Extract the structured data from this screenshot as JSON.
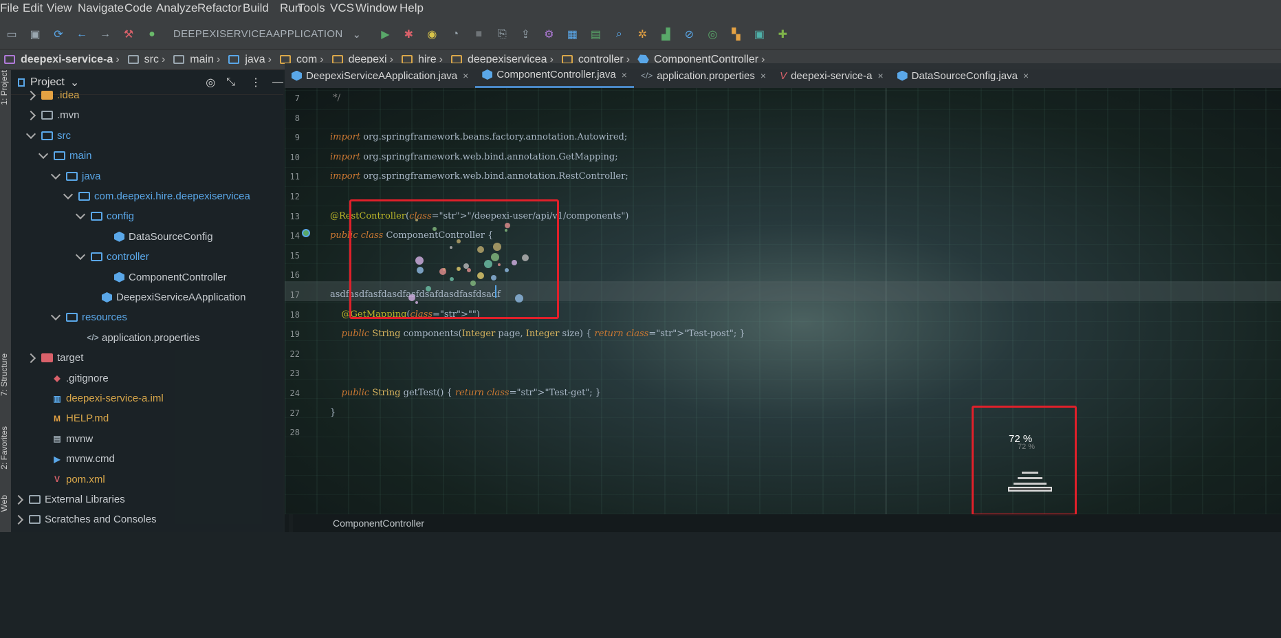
{
  "menu": [
    "File",
    "Edit",
    "View",
    "Navigate",
    "Code",
    "Analyze",
    "Refactor",
    "Build",
    "Run",
    "Tools",
    "VCS",
    "Window",
    "Help"
  ],
  "toolbar": {
    "run_config": "DEEPEXISERVICEAAPPLICATION"
  },
  "breadcrumbs": [
    "deepexi-service-a",
    "src",
    "main",
    "java",
    "com",
    "deepexi",
    "hire",
    "deepexiservicea",
    "controller",
    "ComponentController"
  ],
  "side_tabs": {
    "project": "1: Project",
    "structure": "7: Structure",
    "favorites": "2: Favorites",
    "web": "Web"
  },
  "project_panel": {
    "title": "Project",
    "tree": [
      {
        "label": ".idea",
        "color": "#d9a74a"
      },
      {
        "label": ".mvn",
        "color": "#c8ccd0"
      },
      {
        "label": "src",
        "color": "#5aa7e8"
      },
      {
        "label": "main",
        "color": "#5aa7e8"
      },
      {
        "label": "java",
        "color": "#5aa7e8"
      },
      {
        "label": "com.deepexi.hire.deepexiservicea",
        "color": "#5aa7e8"
      },
      {
        "label": "config",
        "color": "#5aa7e8"
      },
      {
        "label": "DataSourceConfig",
        "color": "#c8ccd0"
      },
      {
        "label": "controller",
        "color": "#5aa7e8"
      },
      {
        "label": "ComponentController",
        "color": "#c8ccd0"
      },
      {
        "label": "DeepexiServiceAApplication",
        "color": "#c8ccd0"
      },
      {
        "label": "resources",
        "color": "#5aa7e8"
      },
      {
        "label": "application.properties",
        "color": "#c8ccd0"
      },
      {
        "label": "target",
        "color": "#c8ccd0"
      },
      {
        "label": ".gitignore",
        "color": "#c8ccd0"
      },
      {
        "label": "deepexi-service-a.iml",
        "color": "#d9a74a"
      },
      {
        "label": "HELP.md",
        "color": "#d9a74a"
      },
      {
        "label": "mvnw",
        "color": "#c8ccd0"
      },
      {
        "label": "mvnw.cmd",
        "color": "#c8ccd0"
      },
      {
        "label": "pom.xml",
        "color": "#d9a74a"
      },
      {
        "label": "External Libraries",
        "color": "#c8ccd0"
      },
      {
        "label": "Scratches and Consoles",
        "color": "#c8ccd0"
      }
    ]
  },
  "tabs": [
    {
      "label": "DeepexiServiceAApplication.java",
      "active": false
    },
    {
      "label": "ComponentController.java",
      "active": true
    },
    {
      "label": "application.properties",
      "active": false
    },
    {
      "label": "deepexi-service-a",
      "active": false
    },
    {
      "label": "DataSourceConfig.java",
      "active": false
    }
  ],
  "code_lines": [
    {
      "num": "7",
      "text": " */"
    },
    {
      "num": "8",
      "text": ""
    },
    {
      "num": "9",
      "text": "import org.springframework.beans.factory.annotation.Autowired;"
    },
    {
      "num": "10",
      "text": "import org.springframework.web.bind.annotation.GetMapping;"
    },
    {
      "num": "11",
      "text": "import org.springframework.web.bind.annotation.RestController;"
    },
    {
      "num": "12",
      "text": ""
    },
    {
      "num": "13",
      "text": "@RestController(\"/deepexi-user/api/v1/components\")"
    },
    {
      "num": "14",
      "text": "public class ComponentController {"
    },
    {
      "num": "15",
      "text": ""
    },
    {
      "num": "16",
      "text": ""
    },
    {
      "num": "17",
      "text": "asdfasdfasfdasdfasfdsafdasdfasfdsadf"
    },
    {
      "num": "18",
      "text": "    @GetMapping(\"\")"
    },
    {
      "num": "19",
      "text": "    public String components(Integer page, Integer size) { return \"Test-post\"; }"
    },
    {
      "num": "22",
      "text": ""
    },
    {
      "num": "23",
      "text": ""
    },
    {
      "num": "24",
      "text": "    public String getTest() { return \"Test-get\"; }"
    },
    {
      "num": "27",
      "text": "}"
    },
    {
      "num": "28",
      "text": ""
    }
  ],
  "status": {
    "breadcrumb": "ComponentController"
  },
  "widget": {
    "percent": "72 %",
    "percent_ghost": "72 %"
  }
}
